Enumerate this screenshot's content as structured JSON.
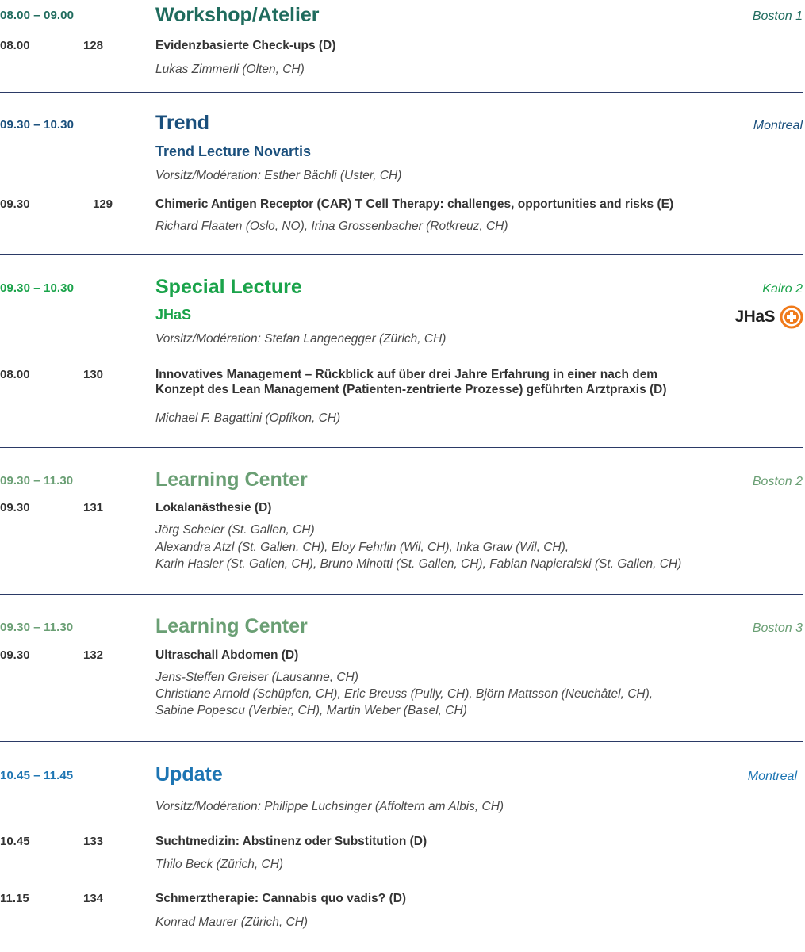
{
  "colors": {
    "workshop": "#1f6b5d",
    "trend": "#1a4f7c",
    "special": "#1aa34a",
    "learning": "#6a9f74",
    "update": "#1d75b3",
    "rule": "#2b3a66",
    "logo_orange": "#f07a1a"
  },
  "sessions": [
    {
      "time": "08.00 – 09.00",
      "title": "Workshop/Atelier",
      "room": "Boston 1",
      "entries": [
        {
          "time": "08.00",
          "num": "128",
          "title": "Evidenzbasierte Check-ups (D)",
          "speaker": "Lukas Zimmerli (Olten, CH)"
        }
      ]
    },
    {
      "time": "09.30 – 10.30",
      "title": "Trend",
      "room": "Montreal",
      "subtitle": "Trend Lecture Novartis",
      "moderation": "Vorsitz/Modération: Esther Bächli (Uster, CH)",
      "entries": [
        {
          "time": "09.30",
          "num": "129",
          "title": "Chimeric Antigen Receptor (CAR) T Cell Therapy: challenges, opportunities and risks (E)",
          "speaker": "Richard Flaaten (Oslo, NO), Irina Grossenbacher (Rotkreuz, CH)"
        }
      ]
    },
    {
      "time": "09.30 – 10.30",
      "title": "Special Lecture",
      "room": "Kairo 2",
      "subtitle": "JHaS",
      "logo_text": "JHaS",
      "logo_icon": "plus-circle-icon",
      "moderation": "Vorsitz/Modération: Stefan Langenegger (Zürich, CH)",
      "entries": [
        {
          "time": "08.00",
          "num": "130",
          "title_line1": "Innovatives Management – Rückblick auf über drei Jahre Erfahrung in einer nach dem",
          "title_line2": "Konzept des Lean Management (Patienten-zentrierte Prozesse) geführten Arztpraxis (D)",
          "speaker": "Michael F. Bagattini (Opfikon, CH)"
        }
      ]
    },
    {
      "time": "09.30 – 11.30",
      "title": "Learning Center",
      "room": "Boston 2",
      "entries": [
        {
          "time": "09.30",
          "num": "131",
          "title": "Lokalanästhesie (D)",
          "speaker_lines": [
            "Jörg Scheler (St. Gallen, CH)",
            "Alexandra Atzl (St. Gallen, CH), Eloy Fehrlin (Wil, CH), Inka Graw (Wil, CH),",
            "Karin Hasler (St. Gallen, CH), Bruno Minotti (St. Gallen, CH), Fabian Napieralski (St. Gallen, CH)"
          ]
        }
      ]
    },
    {
      "time": "09.30 – 11.30",
      "title": "Learning Center",
      "room": "Boston 3",
      "entries": [
        {
          "time": "09.30",
          "num": "132",
          "title": "Ultraschall Abdomen (D)",
          "speaker_lines": [
            "Jens-Steffen Greiser (Lausanne, CH)",
            "Christiane Arnold (Schüpfen, CH), Eric Breuss (Pully, CH), Björn Mattsson (Neuchâtel, CH),",
            "Sabine Popescu (Verbier, CH), Martin Weber (Basel, CH)"
          ]
        }
      ]
    },
    {
      "time": "10.45 – 11.45",
      "title": "Update",
      "room": "Montreal",
      "moderation": "Vorsitz/Modération: Philippe Luchsinger (Affoltern am Albis, CH)",
      "entries": [
        {
          "time": "10.45",
          "num": "133",
          "title": "Suchtmedizin: Abstinenz oder Substitution (D)",
          "speaker": "Thilo Beck (Zürich, CH)"
        },
        {
          "time": "11.15",
          "num": "134",
          "title": "Schmerztherapie: Cannabis quo vadis? (D)",
          "speaker": "Konrad Maurer (Zürich, CH)"
        }
      ]
    }
  ]
}
